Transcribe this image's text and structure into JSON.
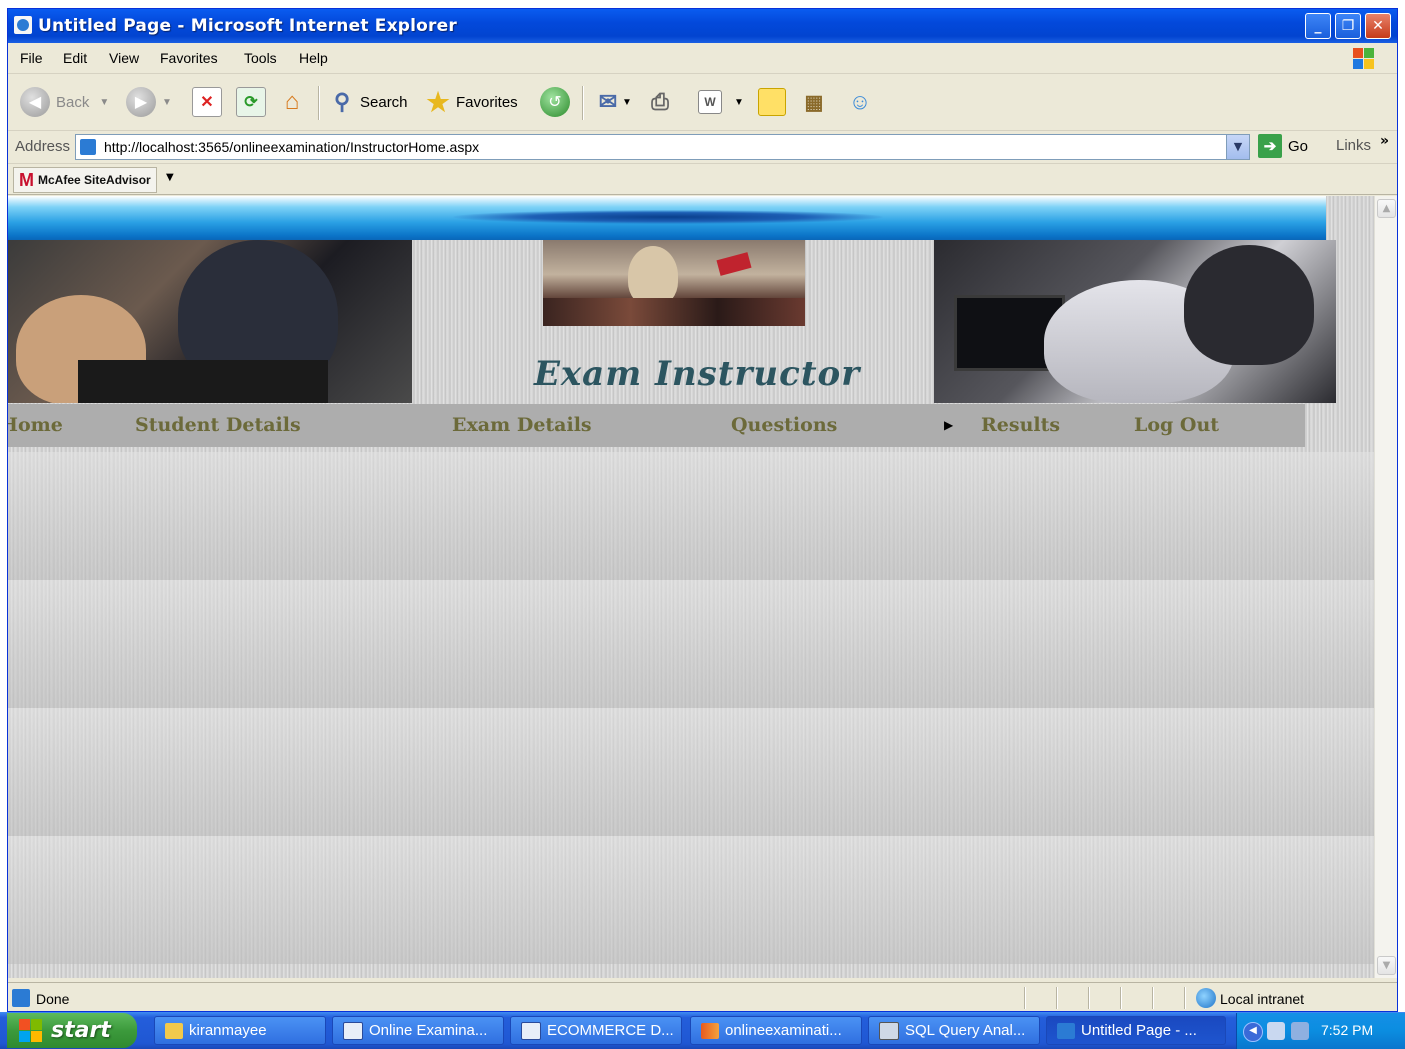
{
  "window": {
    "title": "Untitled Page - Microsoft Internet Explorer",
    "minimize": "_",
    "restore": "❐",
    "close": "✕"
  },
  "menu": [
    "File",
    "Edit",
    "View",
    "Favorites",
    "Tools",
    "Help"
  ],
  "toolbar": {
    "back": "Back",
    "search": "Search",
    "favorites": "Favorites"
  },
  "address": {
    "label": "Address",
    "url": "http://localhost:3565/onlineexamination/InstructorHome.aspx",
    "go": "Go",
    "links": "Links",
    "chevron": "»"
  },
  "mcafee": {
    "logo": "M",
    "label": "McAfee SiteAdvisor"
  },
  "page": {
    "brand": "Exam Instructor",
    "nav": [
      "Home",
      "Student Details",
      "Exam Details",
      "Questions",
      "Results",
      "Log Out"
    ]
  },
  "status": {
    "text": "Done",
    "zone": "Local intranet"
  },
  "taskbar": {
    "start": "start",
    "tasks": [
      "kiranmayee",
      "Online Examina...",
      "ECOMMERCE D...",
      "onlineexaminati...",
      "SQL Query Anal...",
      "Untitled Page - ..."
    ],
    "clock": "7:52 PM"
  },
  "colors": {
    "titlebar": "#0349db",
    "nav_text": "#6c6a3a",
    "brand_text": "#2c5560",
    "band_blue": "#2aa0e4"
  }
}
